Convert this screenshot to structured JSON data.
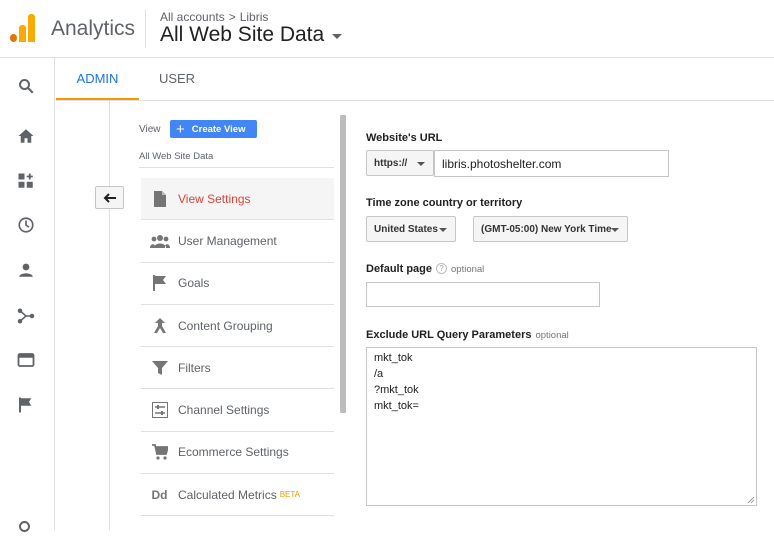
{
  "header": {
    "app_name": "Analytics",
    "breadcrumb_root": "All accounts",
    "breadcrumb_sep": ">",
    "breadcrumb_account": "Libris",
    "property_title": "All Web Site Data"
  },
  "leftnav": {
    "icons": [
      "search-icon",
      "home-icon",
      "customization-icon",
      "realtime-icon",
      "audience-icon",
      "acquisition-icon",
      "behavior-icon",
      "conversions-icon"
    ]
  },
  "tabs": [
    {
      "label": "ADMIN",
      "active": true
    },
    {
      "label": "USER",
      "active": false
    }
  ],
  "view_panel": {
    "view_label": "View",
    "create_view_label": "Create View",
    "view_name": "All Web Site Data",
    "back_arrow": "⟵",
    "menu": [
      {
        "label": "View Settings",
        "icon": "document-icon",
        "active": true
      },
      {
        "label": "User Management",
        "icon": "users-icon"
      },
      {
        "label": "Goals",
        "icon": "flag-icon"
      },
      {
        "label": "Content Grouping",
        "icon": "content-grouping-icon"
      },
      {
        "label": "Filters",
        "icon": "filter-icon"
      },
      {
        "label": "Channel Settings",
        "icon": "channel-settings-icon"
      },
      {
        "label": "Ecommerce Settings",
        "icon": "cart-icon"
      },
      {
        "label": "Calculated Metrics",
        "icon": "dd-icon",
        "badge": "BETA",
        "icon_text": "Dd"
      }
    ]
  },
  "form": {
    "website_url_label": "Website's URL",
    "protocol_value": "https://",
    "url_value": "libris.photoshelter.com",
    "timezone_label": "Time zone country or territory",
    "country_value": "United States",
    "timezone_value": "(GMT-05:00) New York Time",
    "default_page_label": "Default page",
    "default_page_optional": "optional",
    "default_page_value": "",
    "exclude_label": "Exclude URL Query Parameters",
    "exclude_optional": "optional",
    "exclude_lines": [
      "mkt_tok",
      "/a",
      "?mkt_tok",
      "mkt_tok="
    ]
  },
  "colors": {
    "accent_blue": "#1a73e8",
    "tab_underline": "#f29900",
    "active_menu": "#db4437",
    "create_button": "#4285f4"
  }
}
